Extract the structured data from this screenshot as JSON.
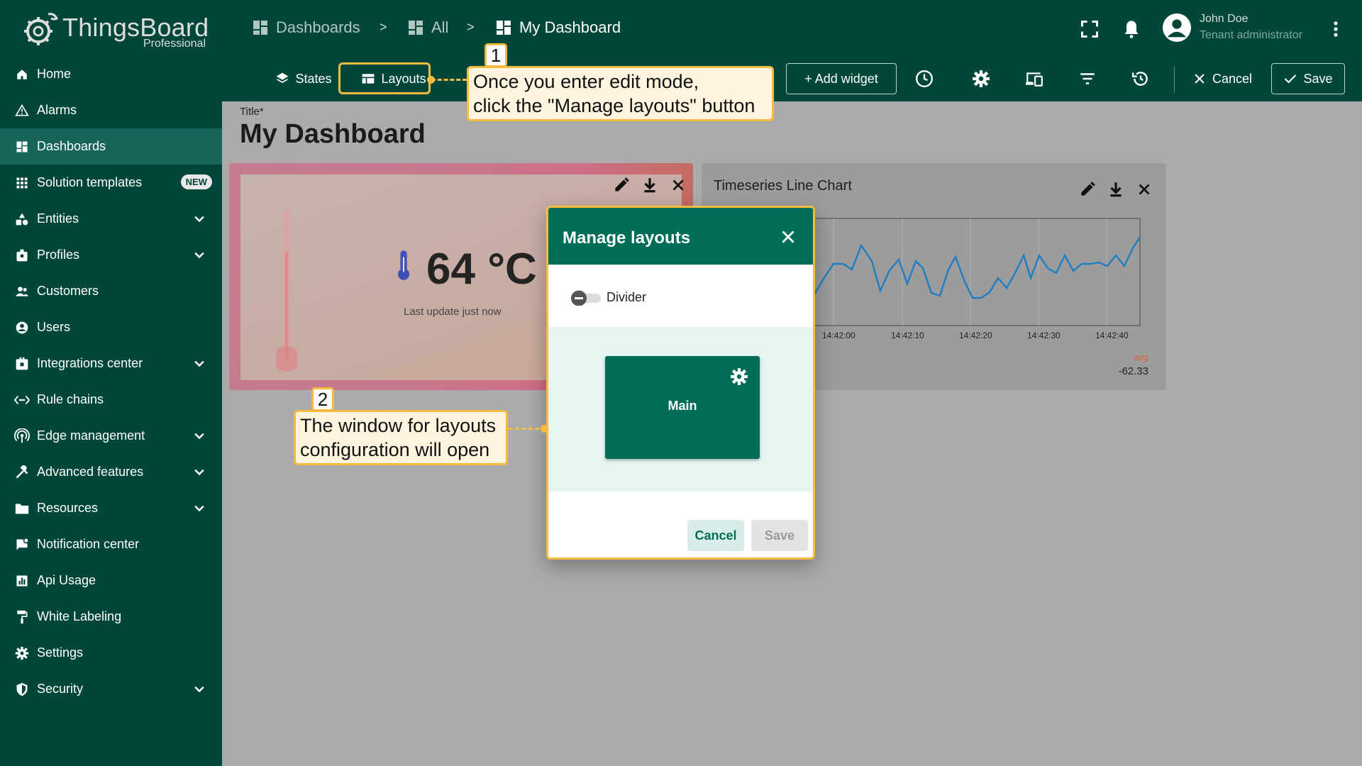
{
  "app": {
    "brand": "ThingsBoard",
    "edition": "Professional"
  },
  "breadcrumb": [
    {
      "label": "Dashboards"
    },
    {
      "label": "All"
    },
    {
      "label": "My Dashboard"
    }
  ],
  "breadcrumb_sep": ">",
  "user": {
    "name": "John Doe",
    "role": "Tenant administrator"
  },
  "sidebar": {
    "items": [
      {
        "label": "Home",
        "icon": "home-icon"
      },
      {
        "label": "Alarms",
        "icon": "warning-icon"
      },
      {
        "label": "Dashboards",
        "icon": "dashboard-icon",
        "active": true
      },
      {
        "label": "Solution templates",
        "icon": "apps-icon",
        "badge": "NEW"
      },
      {
        "label": "Entities",
        "icon": "entities-icon",
        "expandable": true
      },
      {
        "label": "Profiles",
        "icon": "profiles-icon",
        "expandable": true
      },
      {
        "label": "Customers",
        "icon": "customers-icon"
      },
      {
        "label": "Users",
        "icon": "user-icon"
      },
      {
        "label": "Integrations center",
        "icon": "integrations-icon",
        "expandable": true
      },
      {
        "label": "Rule chains",
        "icon": "rule-chain-icon"
      },
      {
        "label": "Edge management",
        "icon": "edge-icon",
        "expandable": true
      },
      {
        "label": "Advanced features",
        "icon": "tools-icon",
        "expandable": true
      },
      {
        "label": "Resources",
        "icon": "folder-icon",
        "expandable": true
      },
      {
        "label": "Notification center",
        "icon": "notification-icon"
      },
      {
        "label": "Api Usage",
        "icon": "chart-icon"
      },
      {
        "label": "White Labeling",
        "icon": "paint-roller-icon"
      },
      {
        "label": "Settings",
        "icon": "gear-icon"
      },
      {
        "label": "Security",
        "icon": "shield-icon",
        "expandable": true
      }
    ]
  },
  "toolbar": {
    "states_label": "States",
    "layouts_label": "Layouts",
    "add_widget_label": "+ Add widget",
    "cancel_label": "Cancel",
    "save_label": "Save"
  },
  "main": {
    "title_label": "Title*",
    "title": "My Dashboard"
  },
  "widgets": {
    "temperature": {
      "value": "64 °C",
      "last_update": "Last update just now"
    },
    "chart": {
      "title": "Timeseries Line Chart",
      "x_ticks": [
        "14:42:00",
        "14:42:10",
        "14:42:20",
        "14:42:30",
        "14:42:40"
      ],
      "legend_label": "avg",
      "legend_value": "-62.33",
      "line_color": "#1f7ec2"
    }
  },
  "dialog": {
    "title": "Manage layouts",
    "toggle_label": "Divider",
    "layout_name": "Main",
    "cancel_label": "Cancel",
    "save_label": "Save"
  },
  "callouts": {
    "step1_number": "1",
    "step1_line1": "Once you enter edit mode,",
    "step1_line2": "click the \"Manage layouts\" button",
    "step2_number": "2",
    "step2_line1": "The window for layouts",
    "step2_line2": "configuration will open"
  },
  "colors": {
    "brand_dark": "#004739",
    "brand": "#006d58",
    "highlight": "#f8bb42"
  }
}
